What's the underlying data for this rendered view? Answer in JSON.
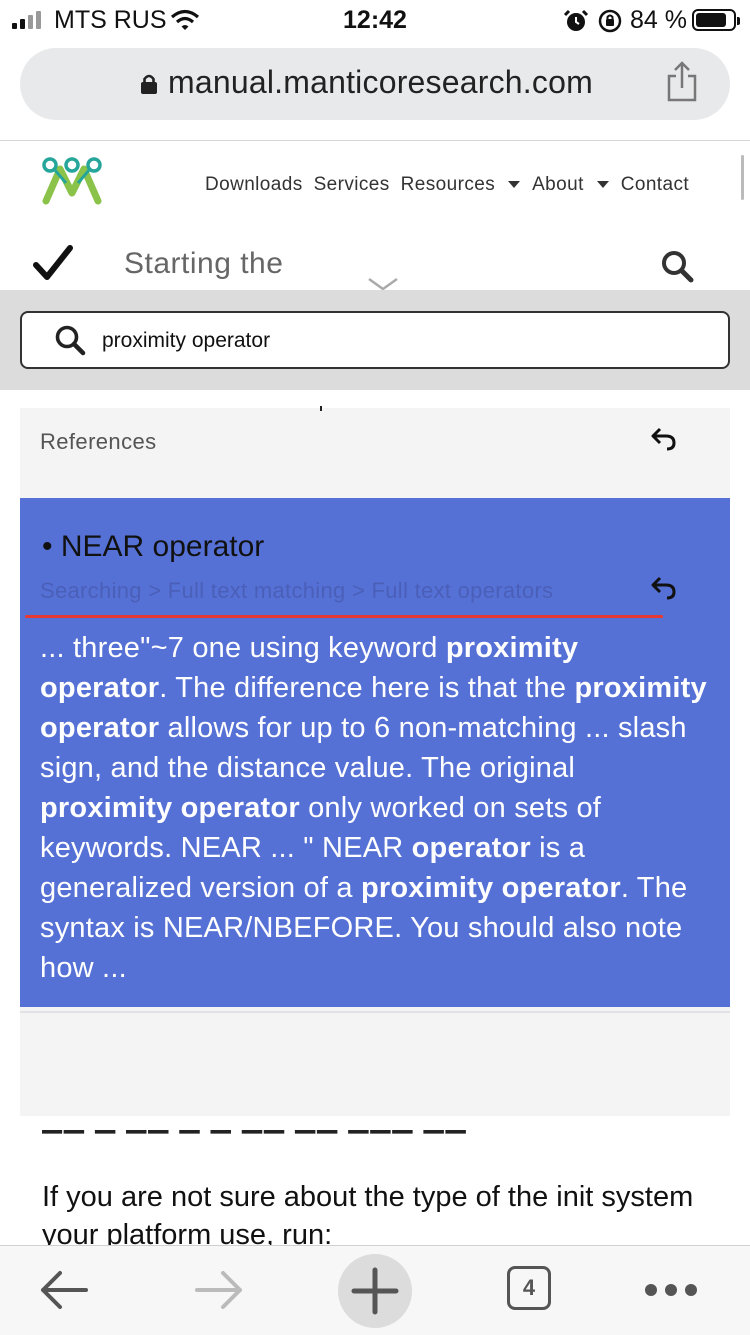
{
  "status_bar": {
    "carrier": "MTS RUS",
    "time": "12:42",
    "battery_percent": "84 %",
    "battery_level": 0.84,
    "icons": [
      "signal-icon",
      "wifi-icon",
      "alarm-icon",
      "orientation-lock-icon",
      "battery-icon"
    ]
  },
  "browser": {
    "url": "manual.manticoresearch.com",
    "tab_count": "4"
  },
  "site_nav": {
    "links": [
      {
        "label": "Downloads"
      },
      {
        "label": "Services"
      },
      {
        "label": "Resources",
        "dropdown": true
      },
      {
        "label": "About",
        "dropdown": true
      },
      {
        "label": "Contact"
      }
    ]
  },
  "doc_header": {
    "title": "Starting the"
  },
  "search": {
    "value": "proximity operator"
  },
  "results": {
    "first": {
      "label": "References"
    },
    "active": {
      "title": "NEAR operator",
      "breadcrumb": "Searching > Full text matching > Full text operators",
      "snippet_parts": [
        {
          "t": "... three\"~7 one using keyword ",
          "b": false
        },
        {
          "t": "proximity operator",
          "b": true
        },
        {
          "t": ". The difference here is that the ",
          "b": false
        },
        {
          "t": "proximity operator",
          "b": true
        },
        {
          "t": " allows for up to 6 non-matching ... slash sign, and the distance value. The original ",
          "b": false
        },
        {
          "t": "proximity operator",
          "b": true
        },
        {
          "t": " only worked on sets of keywords. NEAR ... \" NEAR ",
          "b": false
        },
        {
          "t": "operator",
          "b": true
        },
        {
          "t": " is a generalized version of a ",
          "b": false
        },
        {
          "t": "proximity operator",
          "b": true
        },
        {
          "t": ". The syntax is NEAR/NBEFORE. You should also note how ...",
          "b": false
        }
      ]
    }
  },
  "page_content": {
    "paragraph": "If you are not sure about the type of the init system your platform use, run:"
  },
  "colors": {
    "active_result_bg": "#5671d6",
    "underline": "#e53935",
    "logo_green": "#8bc34a",
    "logo_teal": "#26a69a"
  }
}
